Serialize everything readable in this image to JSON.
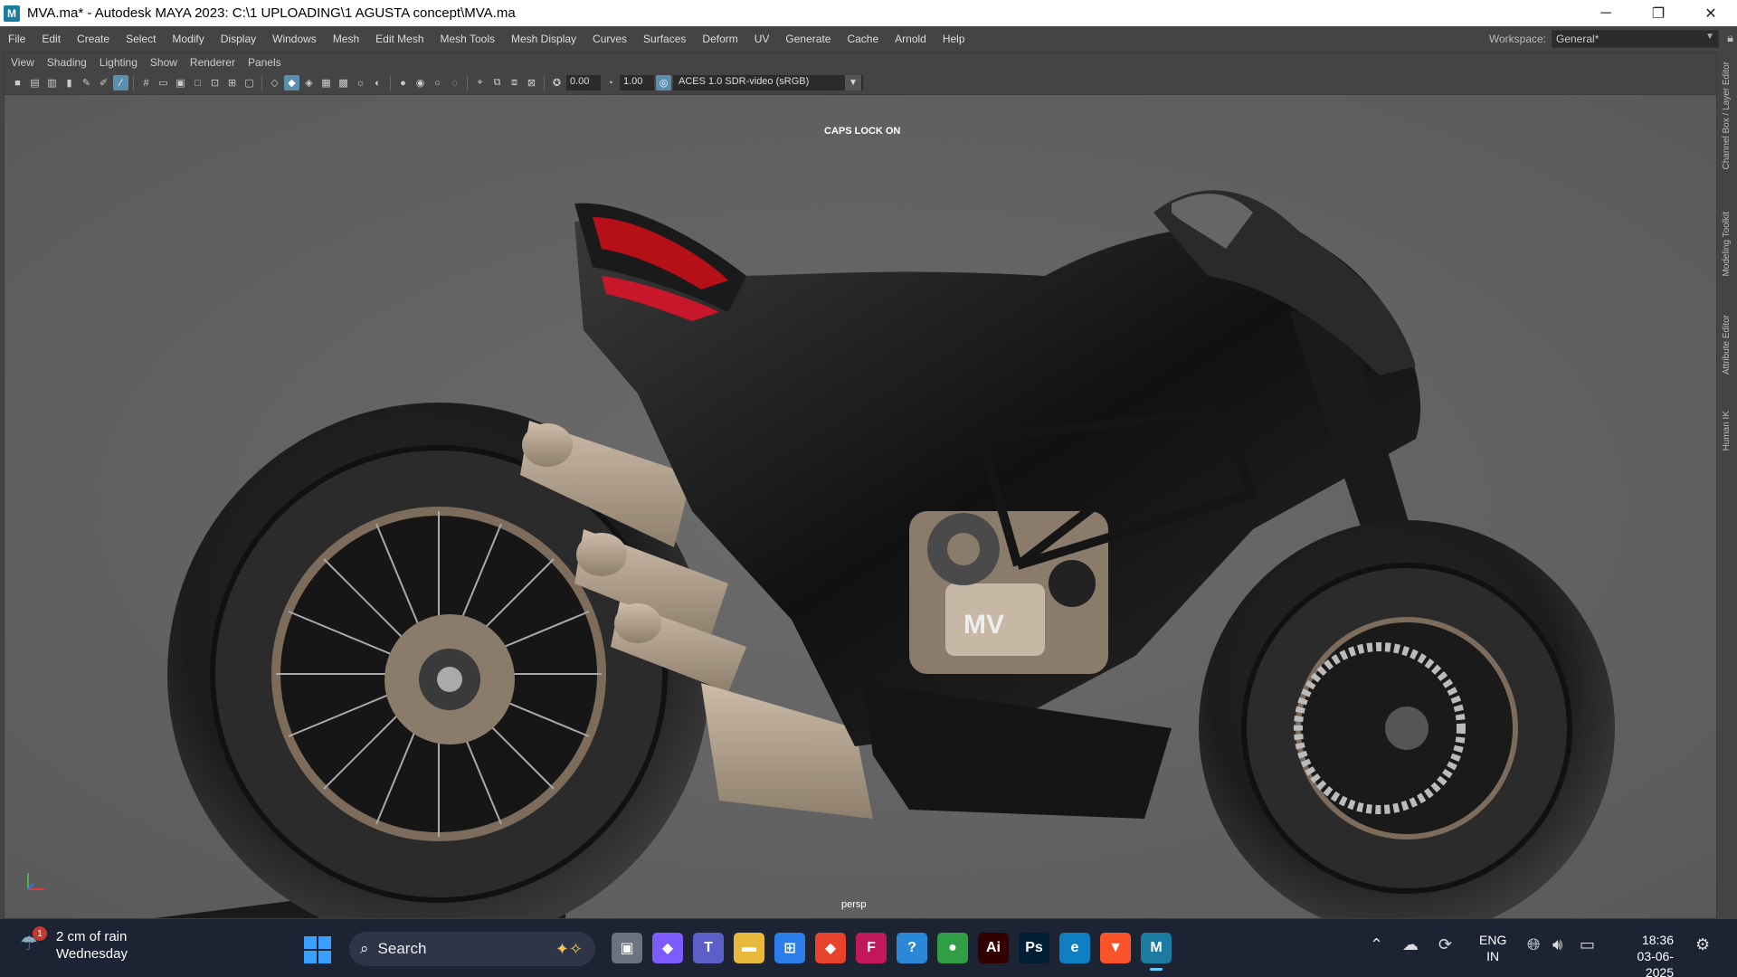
{
  "window": {
    "app_icon_letter": "M",
    "title": "MVA.ma* - Autodesk MAYA 2023: C:\\1 UPLOADING\\1 AGUSTA concept\\MVA.ma",
    "minimize": "─",
    "maximize": "❐",
    "close": "✕"
  },
  "main_menu": [
    "File",
    "Edit",
    "Create",
    "Select",
    "Modify",
    "Display",
    "Windows",
    "Mesh",
    "Edit Mesh",
    "Mesh Tools",
    "Mesh Display",
    "Curves",
    "Surfaces",
    "Deform",
    "UV",
    "Generate",
    "Cache",
    "Arnold",
    "Help"
  ],
  "workspace": {
    "label": "Workspace:",
    "value": "General*"
  },
  "panel_menu": [
    "View",
    "Shading",
    "Lighting",
    "Show",
    "Renderer",
    "Panels"
  ],
  "panel_toolbar": {
    "exposure": "0.00",
    "gamma": "1.00",
    "color_space": "ACES 1.0 SDR-video (sRGB)"
  },
  "viewport": {
    "caps_lock": "CAPS LOCK ON",
    "camera": "persp"
  },
  "side_tabs": [
    "Channel Box / Layer Editor",
    "Modeling Toolkit",
    "Attribute Editor",
    "Human IK"
  ],
  "taskbar": {
    "weather_badge": "1",
    "weather_line1": "2 cm of rain",
    "weather_line2": "Wednesday",
    "search_label": "Search",
    "apps": [
      {
        "name": "task-view",
        "glyph": "▣",
        "color": "#6b7280"
      },
      {
        "name": "copilot",
        "glyph": "◆",
        "color": "#7c5cff"
      },
      {
        "name": "teams",
        "glyph": "T",
        "color": "#5b5fc7"
      },
      {
        "name": "file-explorer",
        "glyph": "▬",
        "color": "#e8b93a"
      },
      {
        "name": "microsoft-store",
        "glyph": "⊞",
        "color": "#2b7de9"
      },
      {
        "name": "anydesk",
        "glyph": "◆",
        "color": "#e8412c"
      },
      {
        "name": "forza",
        "glyph": "F",
        "color": "#c2185b"
      },
      {
        "name": "app-updater",
        "glyph": "?",
        "color": "#2b88d8"
      },
      {
        "name": "chrome",
        "glyph": "●",
        "color": "#2f9e44"
      },
      {
        "name": "illustrator",
        "glyph": "Ai",
        "color": "#330000"
      },
      {
        "name": "photoshop",
        "glyph": "Ps",
        "color": "#001e36"
      },
      {
        "name": "edge",
        "glyph": "e",
        "color": "#0f7fc4"
      },
      {
        "name": "brave",
        "glyph": "▼",
        "color": "#fb542b"
      },
      {
        "name": "maya",
        "glyph": "M",
        "color": "#1b7ba0"
      }
    ],
    "lang_line1": "ENG",
    "lang_line2": "IN",
    "time": "18:36",
    "date": "03-06-2025"
  }
}
